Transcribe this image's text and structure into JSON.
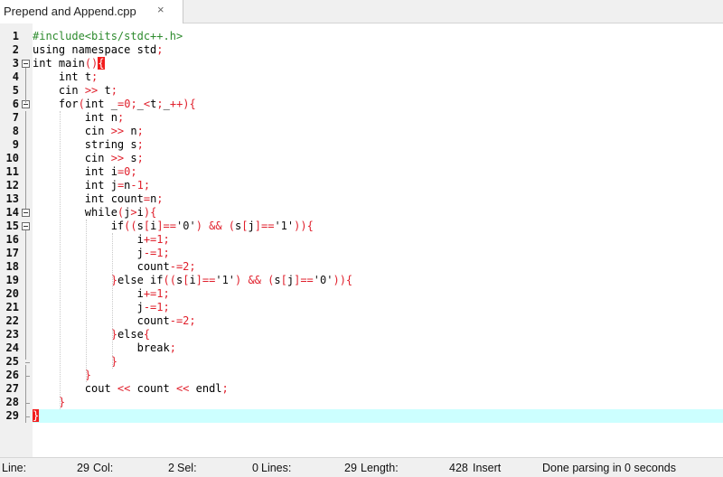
{
  "tab": {
    "title": "Prepend and Append.cpp",
    "close_glyph": "×"
  },
  "code": {
    "line_numbers": [
      "1",
      "2",
      "3",
      "4",
      "5",
      "6",
      "7",
      "8",
      "9",
      "10",
      "11",
      "12",
      "13",
      "14",
      "15",
      "16",
      "17",
      "18",
      "19",
      "20",
      "21",
      "22",
      "23",
      "24",
      "25",
      "26",
      "27",
      "28",
      "29"
    ],
    "lines": [
      [
        [
          "pp",
          "#include<bits/stdc++.h>"
        ]
      ],
      [
        [
          "kw",
          "using namespace "
        ],
        [
          "id",
          "std"
        ],
        [
          "op",
          ";"
        ]
      ],
      [
        [
          "kw",
          "int "
        ],
        [
          "id",
          "main"
        ],
        [
          "op",
          "()"
        ],
        [
          "hl",
          "{"
        ]
      ],
      [
        [
          "t",
          "    "
        ],
        [
          "kw",
          "int "
        ],
        [
          "id",
          "t"
        ],
        [
          "op",
          ";"
        ]
      ],
      [
        [
          "t",
          "    "
        ],
        [
          "id",
          "cin "
        ],
        [
          "op",
          ">>"
        ],
        [
          "id",
          " t"
        ],
        [
          "op",
          ";"
        ]
      ],
      [
        [
          "t",
          "    "
        ],
        [
          "kw",
          "for"
        ],
        [
          "op",
          "("
        ],
        [
          "kw",
          "int "
        ],
        [
          "id",
          "_"
        ],
        [
          "op",
          "="
        ],
        [
          "num",
          "0"
        ],
        [
          "op",
          ";"
        ],
        [
          "id",
          "_"
        ],
        [
          "op",
          "<"
        ],
        [
          "id",
          "t"
        ],
        [
          "op",
          ";"
        ],
        [
          "id",
          "_"
        ],
        [
          "op",
          "++){"
        ]
      ],
      [
        [
          "t",
          "        "
        ],
        [
          "kw",
          "int "
        ],
        [
          "id",
          "n"
        ],
        [
          "op",
          ";"
        ]
      ],
      [
        [
          "t",
          "        "
        ],
        [
          "id",
          "cin "
        ],
        [
          "op",
          ">>"
        ],
        [
          "id",
          " n"
        ],
        [
          "op",
          ";"
        ]
      ],
      [
        [
          "t",
          "        "
        ],
        [
          "id",
          "string s"
        ],
        [
          "op",
          ";"
        ]
      ],
      [
        [
          "t",
          "        "
        ],
        [
          "id",
          "cin "
        ],
        [
          "op",
          ">>"
        ],
        [
          "id",
          " s"
        ],
        [
          "op",
          ";"
        ]
      ],
      [
        [
          "t",
          "        "
        ],
        [
          "kw",
          "int "
        ],
        [
          "id",
          "i"
        ],
        [
          "op",
          "="
        ],
        [
          "num",
          "0"
        ],
        [
          "op",
          ";"
        ]
      ],
      [
        [
          "t",
          "        "
        ],
        [
          "kw",
          "int "
        ],
        [
          "id",
          "j"
        ],
        [
          "op",
          "="
        ],
        [
          "id",
          "n"
        ],
        [
          "op",
          "-"
        ],
        [
          "num",
          "1"
        ],
        [
          "op",
          ";"
        ]
      ],
      [
        [
          "t",
          "        "
        ],
        [
          "kw",
          "int "
        ],
        [
          "id",
          "count"
        ],
        [
          "op",
          "="
        ],
        [
          "id",
          "n"
        ],
        [
          "op",
          ";"
        ]
      ],
      [
        [
          "t",
          "        "
        ],
        [
          "kw",
          "while"
        ],
        [
          "op",
          "("
        ],
        [
          "id",
          "j"
        ],
        [
          "op",
          ">"
        ],
        [
          "id",
          "i"
        ],
        [
          "op",
          "){"
        ]
      ],
      [
        [
          "t",
          "            "
        ],
        [
          "kw",
          "if"
        ],
        [
          "op",
          "(("
        ],
        [
          "id",
          "s"
        ],
        [
          "op",
          "["
        ],
        [
          "id",
          "i"
        ],
        [
          "op",
          "]=="
        ],
        [
          "str",
          "'0'"
        ],
        [
          "op",
          ") && ("
        ],
        [
          "id",
          "s"
        ],
        [
          "op",
          "["
        ],
        [
          "id",
          "j"
        ],
        [
          "op",
          "]=="
        ],
        [
          "str",
          "'1'"
        ],
        [
          "op",
          ")){"
        ]
      ],
      [
        [
          "t",
          "                "
        ],
        [
          "id",
          "i"
        ],
        [
          "op",
          "+="
        ],
        [
          "num",
          "1"
        ],
        [
          "op",
          ";"
        ]
      ],
      [
        [
          "t",
          "                "
        ],
        [
          "id",
          "j"
        ],
        [
          "op",
          "-="
        ],
        [
          "num",
          "1"
        ],
        [
          "op",
          ";"
        ]
      ],
      [
        [
          "t",
          "                "
        ],
        [
          "id",
          "count"
        ],
        [
          "op",
          "-="
        ],
        [
          "num",
          "2"
        ],
        [
          "op",
          ";"
        ]
      ],
      [
        [
          "t",
          "            "
        ],
        [
          "op",
          "}"
        ],
        [
          "kw",
          "else if"
        ],
        [
          "op",
          "(("
        ],
        [
          "id",
          "s"
        ],
        [
          "op",
          "["
        ],
        [
          "id",
          "i"
        ],
        [
          "op",
          "]=="
        ],
        [
          "str",
          "'1'"
        ],
        [
          "op",
          ") && ("
        ],
        [
          "id",
          "s"
        ],
        [
          "op",
          "["
        ],
        [
          "id",
          "j"
        ],
        [
          "op",
          "]=="
        ],
        [
          "str",
          "'0'"
        ],
        [
          "op",
          ")){"
        ]
      ],
      [
        [
          "t",
          "                "
        ],
        [
          "id",
          "i"
        ],
        [
          "op",
          "+="
        ],
        [
          "num",
          "1"
        ],
        [
          "op",
          ";"
        ]
      ],
      [
        [
          "t",
          "                "
        ],
        [
          "id",
          "j"
        ],
        [
          "op",
          "-="
        ],
        [
          "num",
          "1"
        ],
        [
          "op",
          ";"
        ]
      ],
      [
        [
          "t",
          "                "
        ],
        [
          "id",
          "count"
        ],
        [
          "op",
          "-="
        ],
        [
          "num",
          "2"
        ],
        [
          "op",
          ";"
        ]
      ],
      [
        [
          "t",
          "            "
        ],
        [
          "op",
          "}"
        ],
        [
          "kw",
          "else"
        ],
        [
          "op",
          "{"
        ]
      ],
      [
        [
          "t",
          "                "
        ],
        [
          "kw",
          "break"
        ],
        [
          "op",
          ";"
        ]
      ],
      [
        [
          "t",
          "            "
        ],
        [
          "op",
          "}"
        ]
      ],
      [
        [
          "t",
          "        "
        ],
        [
          "op",
          "}"
        ]
      ],
      [
        [
          "t",
          "        "
        ],
        [
          "id",
          "cout "
        ],
        [
          "op",
          "<<"
        ],
        [
          "id",
          " count "
        ],
        [
          "op",
          "<<"
        ],
        [
          "id",
          " endl"
        ],
        [
          "op",
          ";"
        ]
      ],
      [
        [
          "t",
          "    "
        ],
        [
          "op",
          "}"
        ]
      ],
      [
        [
          "hl",
          "}"
        ]
      ]
    ]
  },
  "status": {
    "line_label": "Line:",
    "line_value": "29",
    "col_label": "Col:",
    "col_value": "2",
    "sel_label": "Sel:",
    "sel_value": "0",
    "lines_label": "Lines:",
    "lines_value": "29",
    "length_label": "Length:",
    "length_value": "428",
    "mode": "Insert",
    "message": "Done parsing in 0 seconds"
  }
}
